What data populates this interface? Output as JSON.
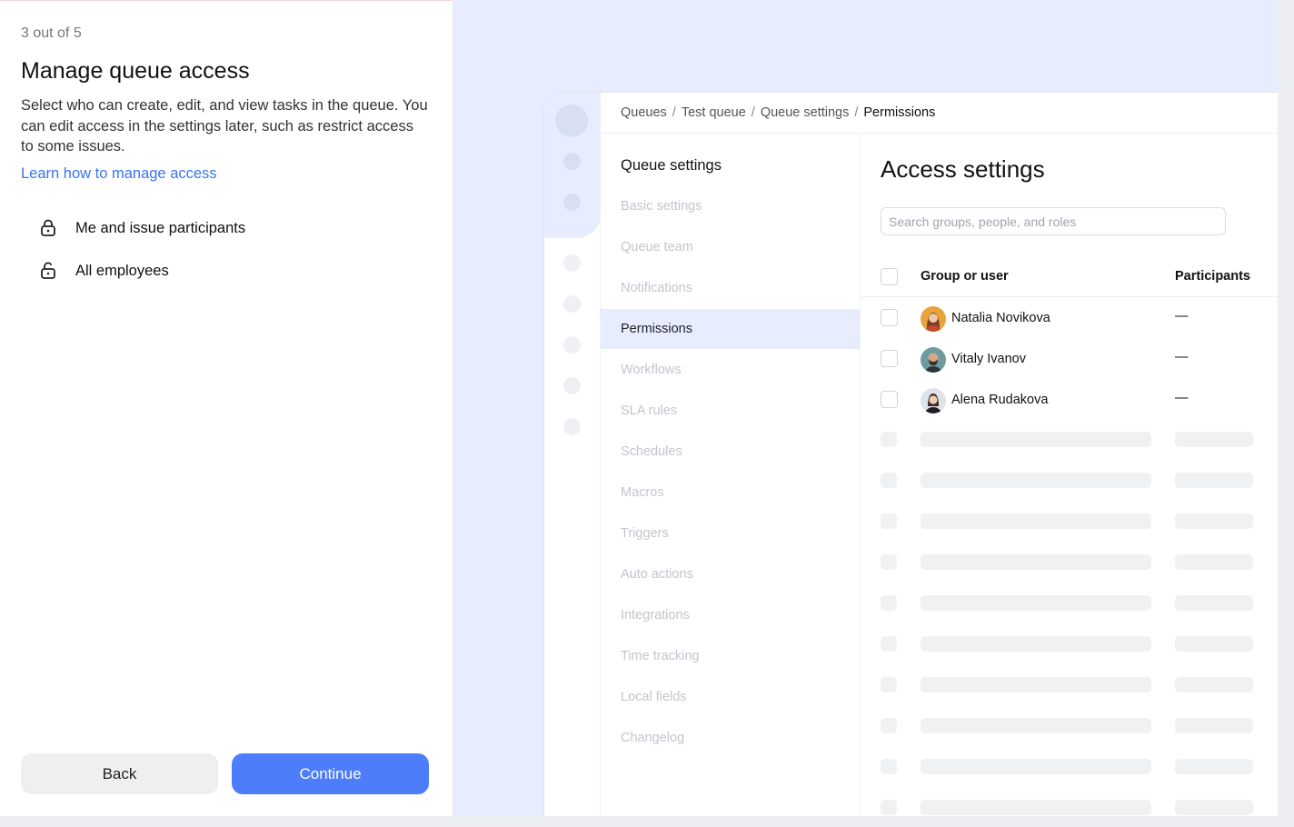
{
  "wizard": {
    "step": "3 out of 5",
    "title": "Manage queue access",
    "description": "Select who can create, edit, and view tasks in the queue. You can edit access in the settings later, such as restrict access to some issues.",
    "learn_link": "Learn how to manage access",
    "options": [
      {
        "label": "Me and issue participants",
        "icon": "lock-closed-icon"
      },
      {
        "label": "All employees",
        "icon": "lock-open-icon"
      }
    ],
    "back_label": "Back",
    "continue_label": "Continue"
  },
  "preview": {
    "breadcrumbs": [
      "Queues",
      "Test queue",
      "Queue settings",
      "Permissions"
    ],
    "nav_title": "Queue settings",
    "nav_items": [
      "Basic settings",
      "Queue team",
      "Notifications",
      "Permissions",
      "Workflows",
      "SLA rules",
      "Schedules",
      "Macros",
      "Triggers",
      "Auto actions",
      "Integrations",
      "Time tracking",
      "Local fields",
      "Changelog"
    ],
    "active_nav": "Permissions",
    "main_title": "Access settings",
    "search_placeholder": "Search groups, people, and roles",
    "columns": {
      "user": "Group or user",
      "participants": "Participants"
    },
    "users": [
      {
        "name": "Natalia Novikova",
        "participants": "—"
      },
      {
        "name": "Vitaly Ivanov",
        "participants": "—"
      },
      {
        "name": "Alena Rudakova",
        "participants": "—"
      }
    ]
  },
  "colors": {
    "accent": "#4d7dfa",
    "link": "#3b73f0",
    "preview_bg": "#e7edfe"
  }
}
